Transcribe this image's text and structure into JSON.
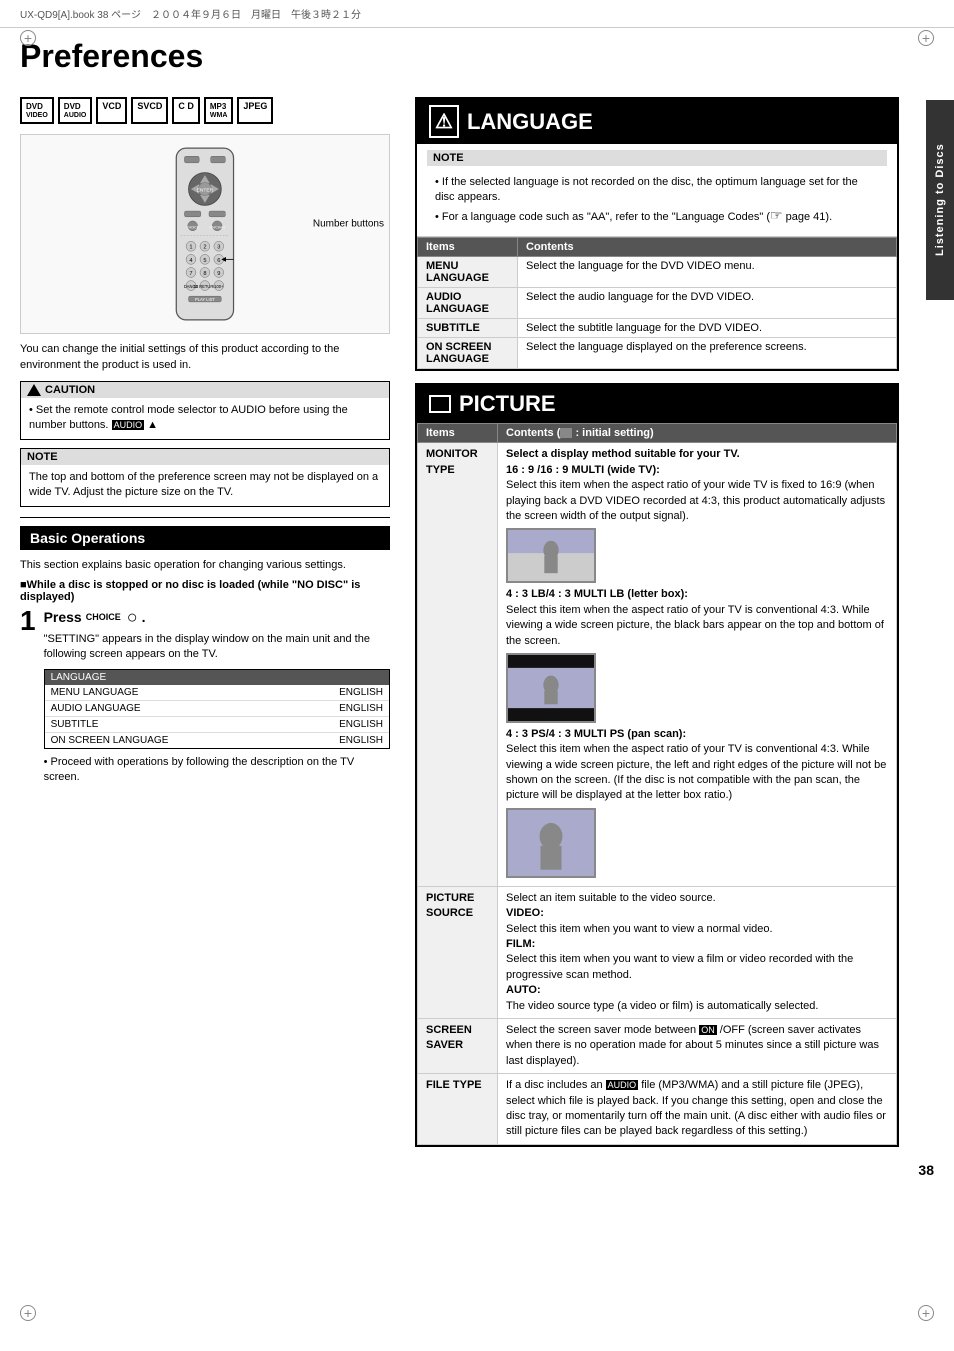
{
  "page": {
    "title": "Preferences",
    "number": "38",
    "top_bar": "UX-QD9[A].book  38 ページ　２００４年９月６日　月曜日　午後３時２１分"
  },
  "right_tab": "Listening to Discs",
  "format_badges": [
    {
      "label": "DVD",
      "sub": "VIDEO"
    },
    {
      "label": "DVD",
      "sub": "AUDIO"
    },
    {
      "label": "VCD"
    },
    {
      "label": "SVCD"
    },
    {
      "label": "CD"
    },
    {
      "label": "MP3",
      "sub": "WMA"
    },
    {
      "label": "JPEG"
    }
  ],
  "number_buttons_label": "Number buttons",
  "caption": "You can change the initial settings of this product according to the environment the product is used in.",
  "caution": {
    "header": "CAUTION",
    "body": "Set the remote control mode selector to AUDIO before using the number buttons."
  },
  "note1": {
    "header": "NOTE",
    "body": "The top and bottom of the preference screen may not be displayed on a wide TV. Adjust the picture size on the TV."
  },
  "basic_operations": {
    "heading": "Basic Operations",
    "intro": "This section explains basic operation for changing various settings.",
    "while_disc": "■While a disc is stopped or no disc is loaded (while \"NO DISC\" is displayed)",
    "step1": {
      "number": "1",
      "title": "Press",
      "choice_label": "CHOICE",
      "icon": "○",
      "desc1": "\"SETTING\" appears in the display window on the main unit and the following screen appears on the TV.",
      "screen": {
        "header": "LANGUAGE",
        "rows": [
          {
            "label": "MENU LANGUAGE",
            "value": "ENGLISH"
          },
          {
            "label": "AUDIO LANGUAGE",
            "value": "ENGLISH"
          },
          {
            "label": "SUBTITLE",
            "value": "ENGLISH"
          },
          {
            "label": "ON SCREEN LANGUAGE",
            "value": "ENGLISH"
          }
        ]
      },
      "desc2": "Proceed with operations by following the description on the TV screen."
    }
  },
  "language_section": {
    "title": "LANGUAGE",
    "note": {
      "header": "NOTE",
      "items": [
        "If the selected language is not recorded on the disc, the optimum language set for the disc appears.",
        "For a language code such as \"AA\", refer to the \"Language Codes\" (page 41)."
      ]
    },
    "table": {
      "headers": [
        "Items",
        "Contents"
      ],
      "rows": [
        {
          "item": "MENU LANGUAGE",
          "content": "Select the language for the DVD VIDEO menu."
        },
        {
          "item": "AUDIO LANGUAGE",
          "content": "Select the audio language for the DVD VIDEO."
        },
        {
          "item": "SUBTITLE",
          "content": "Select the subtitle language for the DVD VIDEO."
        },
        {
          "item": "ON SCREEN LANGUAGE",
          "content": "Select the language displayed on the preference screens."
        }
      ]
    }
  },
  "picture_section": {
    "title": "PICTURE",
    "table": {
      "headers": [
        "Items",
        "Contents (  : initial setting)"
      ],
      "rows": [
        {
          "item": "MONITOR TYPE",
          "content_lines": [
            "Select a display method suitable for your TV.",
            "16 : 9 /16 : 9 MULTI (wide TV):",
            "Select this item when the aspect ratio of your wide TV is fixed to 16:9 (when playing back a DVD VIDEO recorded at 4:3, this product automatically adjusts the screen width of the output signal).",
            "[TV image widescreen]",
            "4 : 3 LB/4 : 3 MULTI LB (letter box):",
            "Select this item when the aspect ratio of your TV is conventional 4:3. While viewing a wide screen picture, the black bars appear on the top and bottom of the screen.",
            "[TV image letterbox]",
            "4 : 3 PS/4 : 3 MULTI PS (pan scan):",
            "Select this item when the aspect ratio of your TV is conventional 4:3. While viewing a wide screen picture, the left and right edges of the picture will not be shown on the screen. (If the disc is not compatible with the pan scan, the picture will be displayed at the letter box ratio.)",
            "[TV image panscan]"
          ]
        },
        {
          "item": "PICTURE SOURCE",
          "content_lines": [
            "Select an item suitable to the video source.",
            "VIDEO:",
            "Select this item when you want to view a normal video.",
            "FILM:",
            "Select this item when you want to view a film or video recorded with the progressive scan method.",
            "AUTO:",
            "The video source type (a video or film) is automatically selected."
          ]
        },
        {
          "item": "SCREEN SAVER",
          "content": "Select the screen saver mode between ON /OFF (screen saver activates when there is no operation made for about 5 minutes since a still picture was last displayed)."
        },
        {
          "item": "FILE TYPE",
          "content": "If a disc includes an AUDIO file (MP3/WMA) and a still picture file (JPEG), select which file is played back. If you change this setting, open and close the disc tray, or momentarily turn off the main unit. (A disc either with audio files or still picture files can be played back regardless of this setting.)"
        }
      ]
    }
  }
}
